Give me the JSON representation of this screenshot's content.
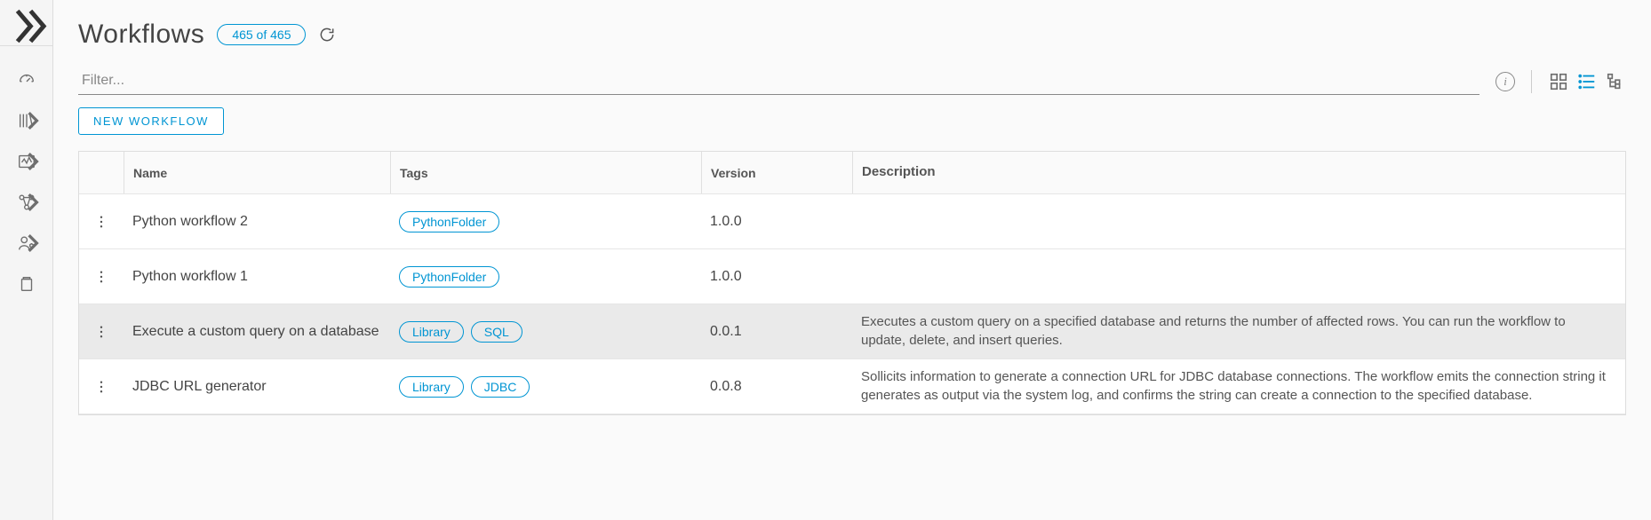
{
  "header": {
    "title": "Workflows",
    "count_badge": "465 of 465"
  },
  "filter": {
    "placeholder": "Filter..."
  },
  "buttons": {
    "new_workflow": "NEW WORKFLOW"
  },
  "table": {
    "columns": {
      "name": "Name",
      "tags": "Tags",
      "version": "Version",
      "description": "Description"
    },
    "rows": [
      {
        "name": "Python workflow 2",
        "tags": [
          "PythonFolder"
        ],
        "version": "1.0.0",
        "description": "",
        "selected": false
      },
      {
        "name": "Python workflow 1",
        "tags": [
          "PythonFolder"
        ],
        "version": "1.0.0",
        "description": "",
        "selected": false
      },
      {
        "name": "Execute a custom query on a database",
        "tags": [
          "Library",
          "SQL"
        ],
        "version": "0.0.1",
        "description": "Executes a custom query on a specified database and returns the number of affected rows. You can run the workflow to update, delete, and insert queries.",
        "selected": true
      },
      {
        "name": "JDBC URL generator",
        "tags": [
          "Library",
          "JDBC"
        ],
        "version": "0.0.8",
        "description": "Sollicits information to generate a connection URL for JDBC database connections. The workflow emits the connection string it generates as output via the system log, and confirms the string can create a connection to the specified database.",
        "selected": false
      }
    ]
  }
}
